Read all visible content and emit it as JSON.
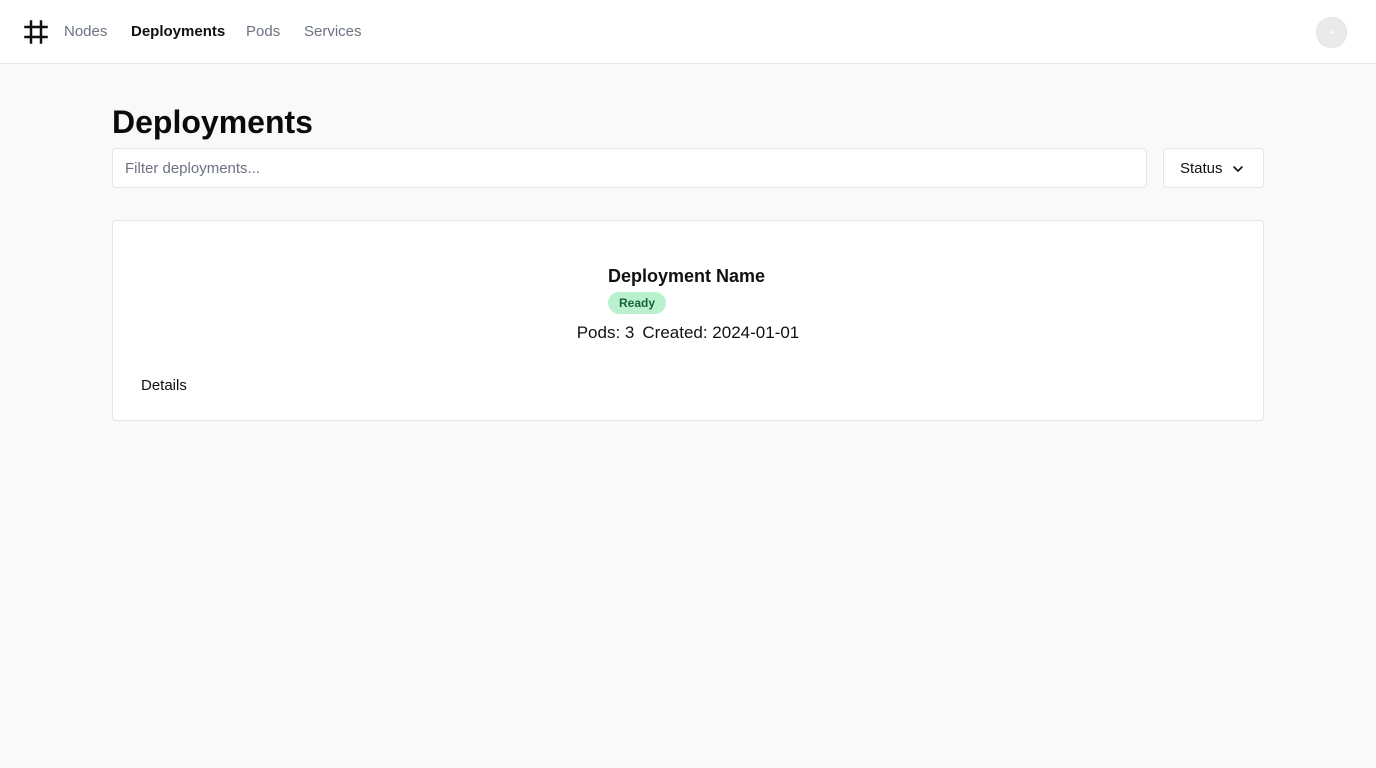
{
  "nav": {
    "links": [
      {
        "label": "Nodes"
      },
      {
        "label": "Deployments"
      },
      {
        "label": "Pods"
      },
      {
        "label": "Services"
      }
    ],
    "active": "Deployments"
  },
  "page": {
    "title": "Deployments"
  },
  "filter": {
    "placeholder": "Filter deployments...",
    "value": ""
  },
  "status_filter": {
    "label": "Status"
  },
  "deployments": [
    {
      "name": "Deployment Name",
      "status": "Ready",
      "pods": "Pods: 3",
      "created": "Created: 2024-01-01",
      "details_label": "Details"
    }
  ],
  "colors": {
    "badge_background": "#bbf0cf",
    "badge_text": "#166534",
    "page_background": "#f8f9f9"
  },
  "icons": {
    "logo": "hash-icon",
    "status_dropdown": "chevron-down-icon",
    "avatar": "user-avatar"
  }
}
